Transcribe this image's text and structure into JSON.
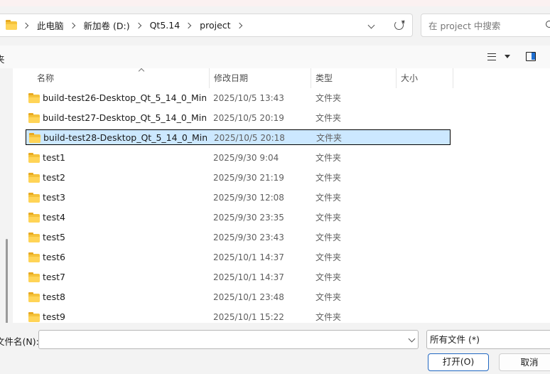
{
  "address": {
    "breadcrumbs": [
      "此电脑",
      "新加卷 (D:)",
      "Qt5.14",
      "project"
    ]
  },
  "search": {
    "placeholder": "在 project 中搜索"
  },
  "toolbar": {
    "organize_label": "夹"
  },
  "columns": {
    "name": "名称",
    "date": "修改日期",
    "type": "类型",
    "size": "大小"
  },
  "files": [
    {
      "name": "build-test26-Desktop_Qt_5_14_0_Min...",
      "date": "2025/10/5 13:43",
      "type": "文件夹"
    },
    {
      "name": "build-test27-Desktop_Qt_5_14_0_Min...",
      "date": "2025/10/5 20:19",
      "type": "文件夹"
    },
    {
      "name": "build-test28-Desktop_Qt_5_14_0_Min...",
      "date": "2025/10/5 20:18",
      "type": "文件夹",
      "selected": true
    },
    {
      "name": "test1",
      "date": "2025/9/30 9:04",
      "type": "文件夹"
    },
    {
      "name": "test2",
      "date": "2025/9/30 21:19",
      "type": "文件夹"
    },
    {
      "name": "test3",
      "date": "2025/9/30 12:08",
      "type": "文件夹"
    },
    {
      "name": "test4",
      "date": "2025/9/30 23:35",
      "type": "文件夹"
    },
    {
      "name": "test5",
      "date": "2025/9/30 23:43",
      "type": "文件夹"
    },
    {
      "name": "test6",
      "date": "2025/10/1 14:37",
      "type": "文件夹"
    },
    {
      "name": "test7",
      "date": "2025/10/1 14:37",
      "type": "文件夹"
    },
    {
      "name": "test8",
      "date": "2025/10/1 23:48",
      "type": "文件夹"
    },
    {
      "name": "test9",
      "date": "2025/10/1 15:22",
      "type": "文件夹"
    }
  ],
  "bottom": {
    "filename_label": "文件名(N):",
    "filename_value": "",
    "filter": "所有文件  (*)",
    "open_label": "打开(O)",
    "cancel_label": "取消"
  },
  "colors": {
    "selection": "#cce8ff",
    "accent": "#2268c2",
    "folder": "#f5c33b"
  }
}
